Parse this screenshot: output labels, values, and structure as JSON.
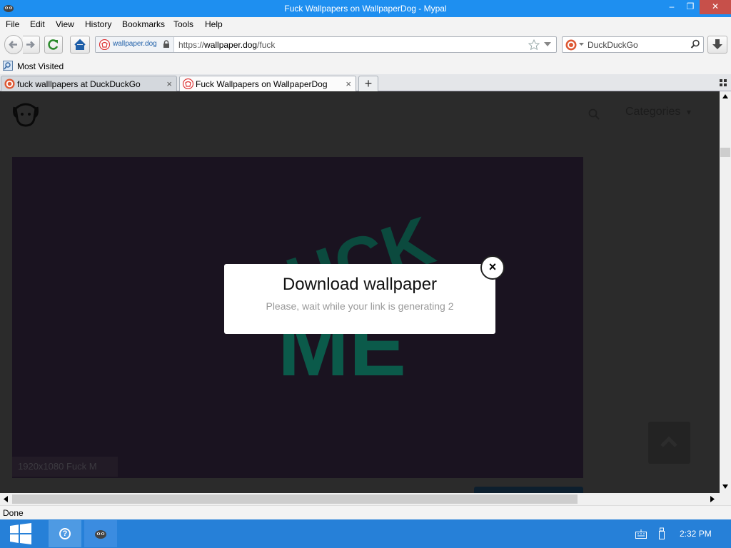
{
  "window": {
    "title": "Fuck Wallpapers on WallpaperDog - Mypal",
    "minimize": "–",
    "restore": "❐",
    "close": "✕"
  },
  "menu": {
    "items": [
      "File",
      "Edit",
      "View",
      "History",
      "Bookmarks",
      "Tools",
      "Help"
    ]
  },
  "navbar": {
    "identity_label": "wallpaper.dog",
    "url_prefix": "https://",
    "url_host": "wallpaper.dog",
    "url_path": "/fuck",
    "search_engine": "DuckDuckGo"
  },
  "bookmarks": {
    "most_visited": "Most Visited"
  },
  "tabs": [
    {
      "label": "fuck walllpapers at DuckDuckGo",
      "close": "×"
    },
    {
      "label": "Fuck Wallpapers on WallpaperDog",
      "close": "×"
    }
  ],
  "new_tab": "+",
  "page": {
    "categories_label": "Categories",
    "categories_caret": "▾",
    "wallpaper_caption": "1920x1080 Fuck M",
    "wallpaper_text_top": "UCK",
    "wallpaper_text_bottom": "ME",
    "modal": {
      "title": "Download wallpaper",
      "subtitle": "Please, wait while your link is generating 2",
      "close_glyph": "×"
    }
  },
  "status": {
    "text": "Done"
  },
  "taskbar": {
    "help_glyph": "?",
    "clock": "2:32 PM"
  },
  "colors": {
    "titlebar": "#1e8ff0",
    "taskbar": "#2680d8",
    "wallpaper_green": "#0b5a4a",
    "overlay": "#2b2b2b"
  }
}
